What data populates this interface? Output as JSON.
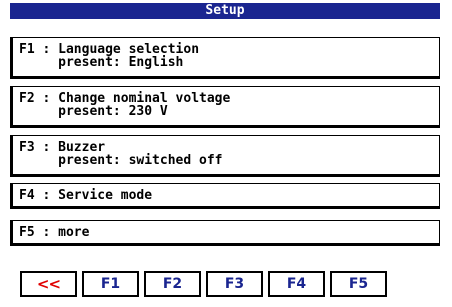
{
  "title": "Setup",
  "menu": [
    {
      "key": "F1",
      "sep": " : ",
      "line1": "Language selection",
      "line2": "present: English"
    },
    {
      "key": "F2",
      "sep": " : ",
      "line1": "Change nominal voltage",
      "line2": "present: 230 V"
    },
    {
      "key": "F3",
      "sep": " : ",
      "line1": "Buzzer",
      "line2": "present: switched off"
    },
    {
      "key": "F4",
      "sep": " : ",
      "line1": "Service mode"
    },
    {
      "key": "F5",
      "sep": " : ",
      "line1": "more"
    }
  ],
  "fkeys": [
    "<<",
    "F1",
    "F2",
    "F3",
    "F4",
    "F5"
  ],
  "colors": {
    "titlebar": "#1a2590",
    "fkey_text": "#1a2590",
    "back_key": "#e00000"
  }
}
